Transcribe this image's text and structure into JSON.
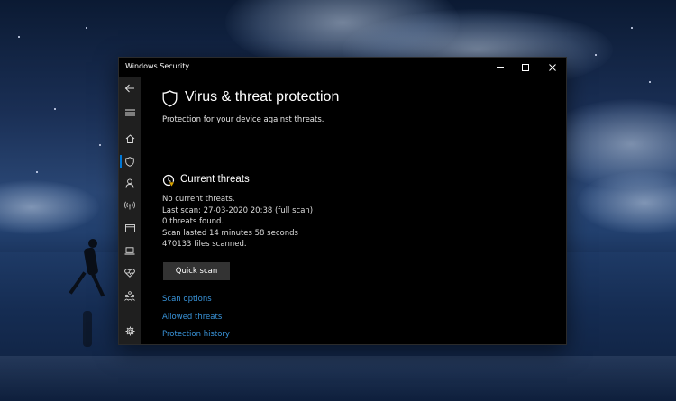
{
  "window": {
    "title": "Windows Security"
  },
  "titlebar": {
    "minimize": "minimize",
    "maximize": "maximize",
    "close": "close"
  },
  "sidebar": {
    "items": [
      {
        "icon": "back-arrow-icon"
      },
      {
        "icon": "hamburger-menu-icon"
      },
      {
        "icon": "home-icon"
      },
      {
        "icon": "shield-icon",
        "active": true
      },
      {
        "icon": "person-icon"
      },
      {
        "icon": "wifi-antenna-icon"
      },
      {
        "icon": "app-browser-icon"
      },
      {
        "icon": "laptop-icon"
      },
      {
        "icon": "heart-icon"
      },
      {
        "icon": "family-icon"
      },
      {
        "icon": "gear-icon"
      }
    ],
    "accent": "#0078d7"
  },
  "page": {
    "title": "Virus & threat protection",
    "subtitle": "Protection for your device against threats."
  },
  "current_threats": {
    "heading": "Current threats",
    "lines": [
      "No current threats.",
      "Last scan: 27-03-2020 20:38 (full scan)",
      "0 threats found.",
      "Scan lasted 14 minutes 58 seconds",
      "470133 files scanned."
    ],
    "button": "Quick scan"
  },
  "links": {
    "scan_options": "Scan options",
    "allowed_threats": "Allowed threats",
    "protection_history": "Protection history",
    "color": "#3a96dd"
  }
}
